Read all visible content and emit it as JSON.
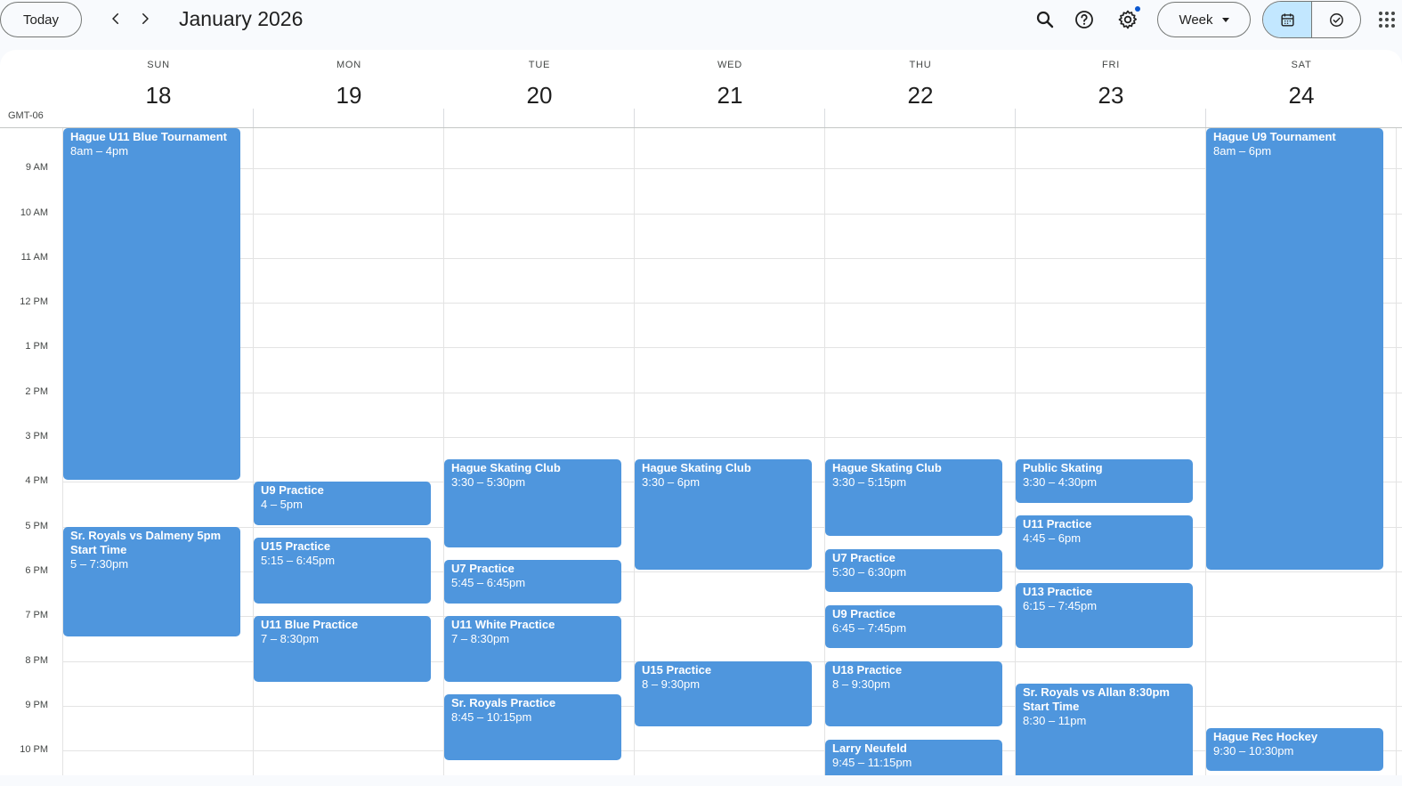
{
  "header": {
    "today_label": "Today",
    "month_title": "January 2026",
    "view_label": "Week",
    "timezone": "GMT-06"
  },
  "icons": {
    "prev": "chevron-left-icon",
    "next": "chevron-right-icon",
    "search": "search-icon",
    "help": "help-icon",
    "settings": "gear-icon",
    "calendar_view": "calendar-icon",
    "tasks_view": "task-check-icon",
    "apps": "apps-grid-icon"
  },
  "colors": {
    "event": "#4f96dd",
    "accent": "#0b57d0",
    "segment_active": "#c2e7ff"
  },
  "days": [
    {
      "dow": "SUN",
      "num": "18"
    },
    {
      "dow": "MON",
      "num": "19"
    },
    {
      "dow": "TUE",
      "num": "20"
    },
    {
      "dow": "WED",
      "num": "21"
    },
    {
      "dow": "THU",
      "num": "22"
    },
    {
      "dow": "FRI",
      "num": "23"
    },
    {
      "dow": "SAT",
      "num": "24"
    }
  ],
  "time_labels": [
    "9 AM",
    "10 AM",
    "11 AM",
    "12 PM",
    "1 PM",
    "2 PM",
    "3 PM",
    "4 PM",
    "5 PM",
    "6 PM",
    "7 PM",
    "8 PM",
    "9 PM",
    "10 PM"
  ],
  "events": [
    {
      "day": 0,
      "start": 8,
      "end": 16,
      "title": "Hague U11 Blue Tournament",
      "time": "8am – 4pm"
    },
    {
      "day": 0,
      "start": 17,
      "end": 19.5,
      "title": "Sr. Royals vs Dalmeny 5pm Start Time",
      "time": "5 – 7:30pm"
    },
    {
      "day": 1,
      "start": 16,
      "end": 17,
      "title": "U9 Practice",
      "time": "4 – 5pm"
    },
    {
      "day": 1,
      "start": 17.25,
      "end": 18.75,
      "title": "U15 Practice",
      "time": "5:15 – 6:45pm"
    },
    {
      "day": 1,
      "start": 19,
      "end": 20.5,
      "title": "U11 Blue Practice",
      "time": "7 – 8:30pm"
    },
    {
      "day": 2,
      "start": 15.5,
      "end": 17.5,
      "title": "Hague Skating Club",
      "time": "3:30 – 5:30pm"
    },
    {
      "day": 2,
      "start": 17.75,
      "end": 18.75,
      "title": "U7 Practice",
      "time": "5:45 – 6:45pm"
    },
    {
      "day": 2,
      "start": 19,
      "end": 20.5,
      "title": "U11 White Practice",
      "time": "7 – 8:30pm"
    },
    {
      "day": 2,
      "start": 20.75,
      "end": 22.25,
      "title": "Sr. Royals Practice",
      "time": "8:45 – 10:15pm"
    },
    {
      "day": 3,
      "start": 15.5,
      "end": 18,
      "title": "Hague Skating Club",
      "time": "3:30 – 6pm"
    },
    {
      "day": 3,
      "start": 20,
      "end": 21.5,
      "title": "U15 Practice",
      "time": "8 – 9:30pm"
    },
    {
      "day": 4,
      "start": 15.5,
      "end": 17.25,
      "title": "Hague Skating Club",
      "time": "3:30 – 5:15pm"
    },
    {
      "day": 4,
      "start": 17.5,
      "end": 18.5,
      "title": "U7 Practice",
      "time": "5:30 – 6:30pm"
    },
    {
      "day": 4,
      "start": 18.75,
      "end": 19.75,
      "title": "U9 Practice",
      "time": "6:45 – 7:45pm"
    },
    {
      "day": 4,
      "start": 20,
      "end": 21.5,
      "title": "U18 Practice",
      "time": "8 – 9:30pm"
    },
    {
      "day": 4,
      "start": 21.75,
      "end": 23.25,
      "title": "Larry Neufeld",
      "time": "9:45 – 11:15pm"
    },
    {
      "day": 5,
      "start": 15.5,
      "end": 16.5,
      "title": "Public Skating",
      "time": "3:30 – 4:30pm"
    },
    {
      "day": 5,
      "start": 16.75,
      "end": 18,
      "title": "U11 Practice",
      "time": "4:45 – 6pm"
    },
    {
      "day": 5,
      "start": 18.25,
      "end": 19.75,
      "title": "U13 Practice",
      "time": "6:15 – 7:45pm"
    },
    {
      "day": 5,
      "start": 20.5,
      "end": 23,
      "title": "Sr. Royals vs Allan 8:30pm Start Time",
      "time": "8:30 – 11pm"
    },
    {
      "day": 6,
      "start": 8,
      "end": 18,
      "title": "Hague U9 Tournament",
      "time": "8am – 6pm"
    },
    {
      "day": 6,
      "start": 21.5,
      "end": 22.5,
      "title": "Hague Rec Hockey",
      "time": "9:30 – 10:30pm"
    }
  ]
}
